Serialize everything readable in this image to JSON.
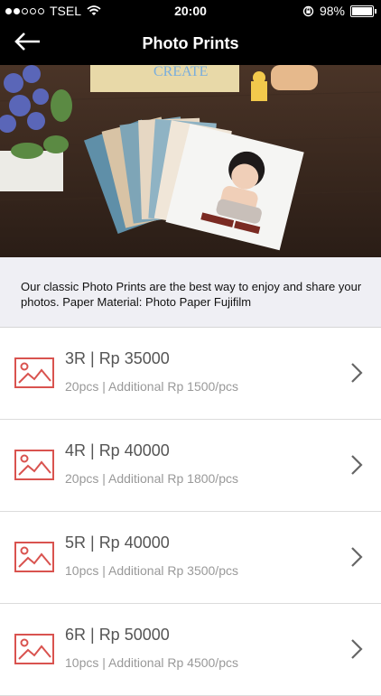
{
  "status_bar": {
    "carrier": "TSEL",
    "time": "20:00",
    "battery": "98%",
    "signal_bars_filled": 2,
    "signal_bars_total": 5
  },
  "nav": {
    "title": "Photo Prints",
    "back_icon": "back-arrow-icon"
  },
  "hero": {
    "box_text": "CREATE"
  },
  "description": "Our classic Photo Prints are the best way to enjoy and share your photos. Paper Material: Photo Paper Fujifilm",
  "products": [
    {
      "title": "3R | Rp 35000",
      "subtitle": "20pcs | Additional Rp 1500/pcs"
    },
    {
      "title": "4R | Rp 40000",
      "subtitle": "20pcs | Additional Rp 1800/pcs"
    },
    {
      "title": "5R | Rp 40000",
      "subtitle": "10pcs | Additional Rp 3500/pcs"
    },
    {
      "title": "6R | Rp 50000",
      "subtitle": "10pcs | Additional Rp 4500/pcs"
    }
  ],
  "colors": {
    "accent_red": "#d9534f",
    "bar_background": "#000000",
    "description_background": "#efeff4"
  }
}
